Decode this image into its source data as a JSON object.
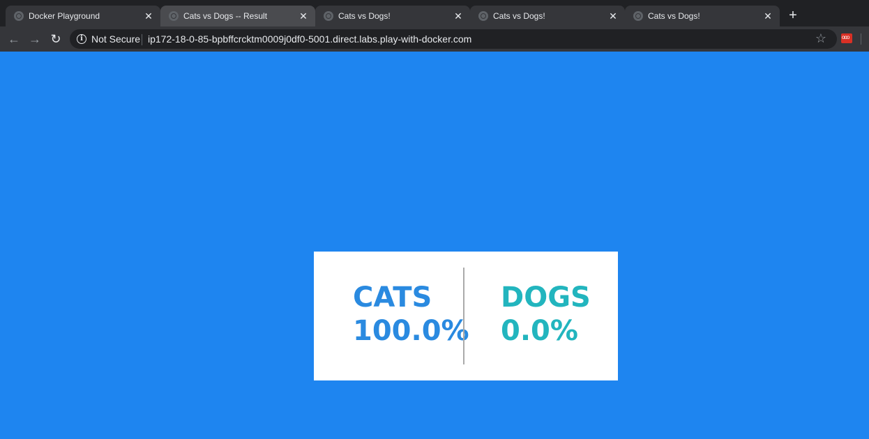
{
  "tabs": [
    {
      "title": "Docker Playground",
      "active": false
    },
    {
      "title": "Cats vs Dogs -- Result",
      "active": true
    },
    {
      "title": "Cats vs Dogs!",
      "active": false
    },
    {
      "title": "Cats vs Dogs!",
      "active": false
    },
    {
      "title": "Cats vs Dogs!",
      "active": false
    }
  ],
  "toolbar": {
    "security_label": "Not Secure",
    "url": "ip172-18-0-85-bpbffcrcktm0009j0df0-5001.direct.labs.play-with-docker.com"
  },
  "result": {
    "cats": {
      "label": "CATS",
      "percent": "100.0%"
    },
    "dogs": {
      "label": "DOGS",
      "percent": "0.0%"
    }
  },
  "colors": {
    "page_background": "#1e85f0",
    "cats": "#2a8ae0",
    "dogs": "#22b5be",
    "card": "#ffffff"
  },
  "icons": {
    "tab_favicon": "globe-icon",
    "tab_close": "close-icon",
    "new_tab": "plus-icon",
    "back": "back-arrow-icon",
    "forward": "forward-arrow-icon",
    "reload": "reload-icon",
    "security": "info-icon",
    "bookmark": "star-icon",
    "extension": "extension-icon"
  }
}
